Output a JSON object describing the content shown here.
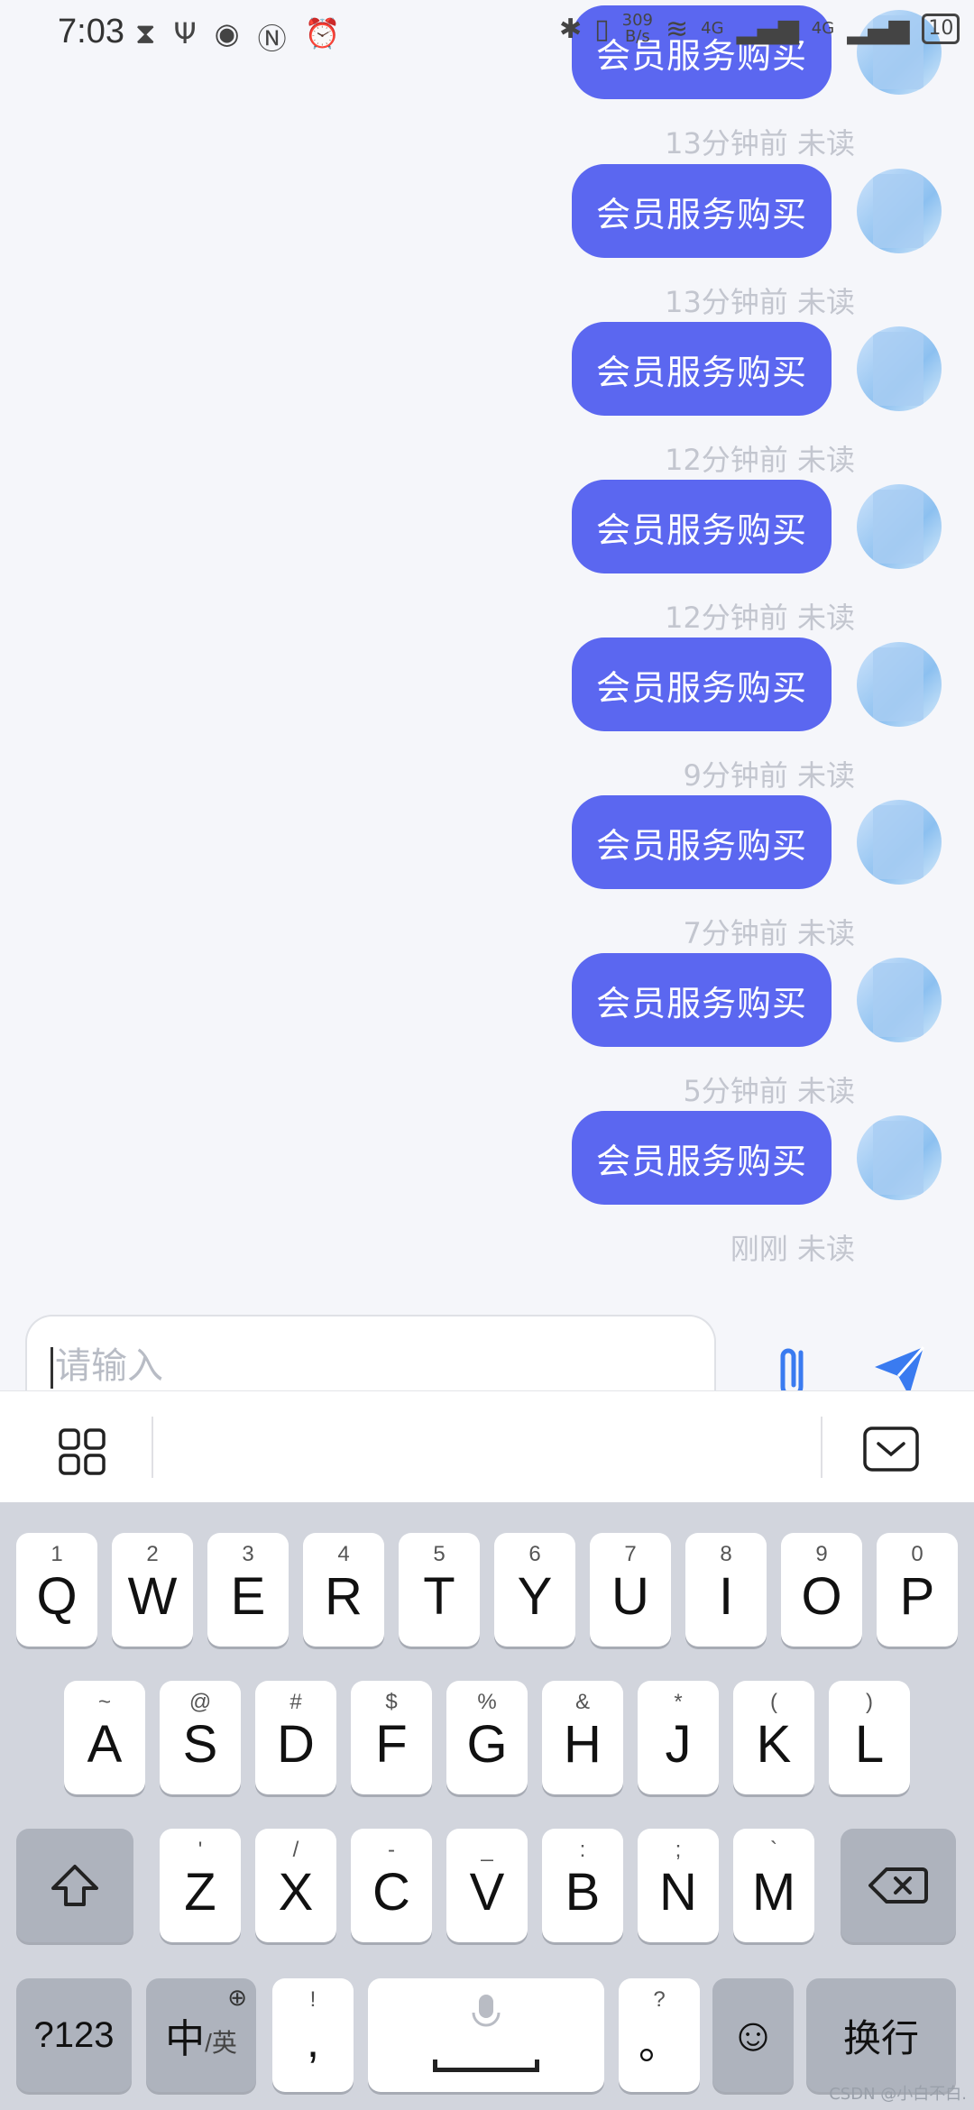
{
  "status_bar": {
    "time": "7:03",
    "speed_top": "309",
    "speed_bottom": "B/s",
    "net1": "4G",
    "net2": "4G",
    "battery": "10"
  },
  "messages": [
    {
      "text": "会员服务购买",
      "time": "13分钟前",
      "status": "未读"
    },
    {
      "text": "会员服务购买",
      "time": "13分钟前",
      "status": "未读"
    },
    {
      "text": "会员服务购买",
      "time": "12分钟前",
      "status": "未读"
    },
    {
      "text": "会员服务购买",
      "time": "12分钟前",
      "status": "未读"
    },
    {
      "text": "会员服务购买",
      "time": "9分钟前",
      "status": "未读"
    },
    {
      "text": "会员服务购买",
      "time": "7分钟前",
      "status": "未读"
    },
    {
      "text": "会员服务购买",
      "time": "5分钟前",
      "status": "未读"
    },
    {
      "text": "会员服务购买",
      "time": "刚刚",
      "status": "未读"
    }
  ],
  "composer": {
    "placeholder": "请输入"
  },
  "keyboard": {
    "row1": [
      {
        "sub": "1",
        "main": "Q"
      },
      {
        "sub": "2",
        "main": "W"
      },
      {
        "sub": "3",
        "main": "E"
      },
      {
        "sub": "4",
        "main": "R"
      },
      {
        "sub": "5",
        "main": "T"
      },
      {
        "sub": "6",
        "main": "Y"
      },
      {
        "sub": "7",
        "main": "U"
      },
      {
        "sub": "8",
        "main": "I"
      },
      {
        "sub": "9",
        "main": "O"
      },
      {
        "sub": "0",
        "main": "P"
      }
    ],
    "row2": [
      {
        "sub": "~",
        "main": "A"
      },
      {
        "sub": "@",
        "main": "S"
      },
      {
        "sub": "#",
        "main": "D"
      },
      {
        "sub": "$",
        "main": "F"
      },
      {
        "sub": "%",
        "main": "G"
      },
      {
        "sub": "&",
        "main": "H"
      },
      {
        "sub": "*",
        "main": "J"
      },
      {
        "sub": "(",
        "main": "K"
      },
      {
        "sub": ")",
        "main": "L"
      }
    ],
    "row3": [
      {
        "sub": "'",
        "main": "Z"
      },
      {
        "sub": "/",
        "main": "X"
      },
      {
        "sub": "-",
        "main": "C"
      },
      {
        "sub": "_",
        "main": "V"
      },
      {
        "sub": ":",
        "main": "B"
      },
      {
        "sub": ";",
        "main": "N"
      },
      {
        "sub": "`",
        "main": "M"
      }
    ],
    "num_key": "?123",
    "lang_main": "中",
    "lang_sub": "/英",
    "comma_sub": "!",
    "comma_main": ",",
    "period_sub": "?",
    "period_main": "。",
    "enter_key": "换行"
  },
  "watermark": "CSDN @小白不白."
}
